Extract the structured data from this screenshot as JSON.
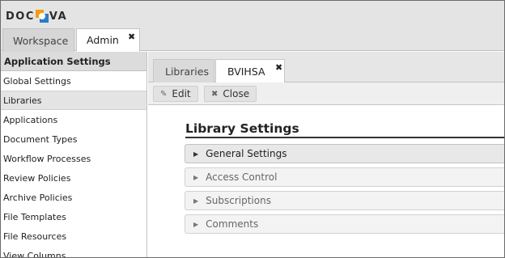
{
  "app": {
    "logo_text_left": "DOC",
    "logo_text_right": "VA"
  },
  "main_tabs": [
    {
      "label": "Workspace"
    },
    {
      "label": "Admin",
      "close": "✖"
    }
  ],
  "sidebar": {
    "header": "Application Settings",
    "items": [
      {
        "label": "Global Settings"
      },
      {
        "label": "Libraries",
        "selected": true
      },
      {
        "label": "Applications"
      },
      {
        "label": "Document Types"
      },
      {
        "label": "Workflow Processes"
      },
      {
        "label": "Review Policies"
      },
      {
        "label": "Archive Policies"
      },
      {
        "label": "File Templates"
      },
      {
        "label": "File Resources"
      },
      {
        "label": "View Columns"
      }
    ]
  },
  "sub_tabs": [
    {
      "label": "Libraries"
    },
    {
      "label": "BVIHSA",
      "close": "✖"
    }
  ],
  "toolbar": {
    "edit_label": "Edit",
    "edit_icon": "✎",
    "close_label": "Close",
    "close_icon": "✖"
  },
  "content": {
    "title": "Library Settings",
    "sections": [
      {
        "label": "General Settings",
        "arrow": "▶"
      },
      {
        "label": "Access Control",
        "arrow": "▶"
      },
      {
        "label": "Subscriptions",
        "arrow": "▶"
      },
      {
        "label": "Comments",
        "arrow": "▶"
      }
    ]
  }
}
